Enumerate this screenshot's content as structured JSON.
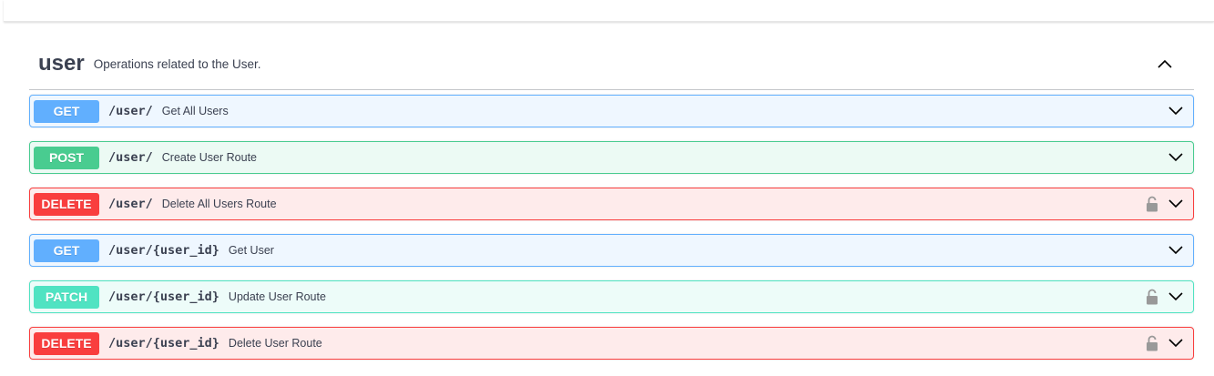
{
  "tag": {
    "name": "user",
    "description": "Operations related to the User."
  },
  "colors": {
    "get": "#61affe",
    "post": "#49cc90",
    "delete": "#f93e3e",
    "patch": "#50e3c2"
  },
  "operations": [
    {
      "method": "GET",
      "path": "/user/",
      "summary": "Get All Users",
      "locked": false
    },
    {
      "method": "POST",
      "path": "/user/",
      "summary": "Create User Route",
      "locked": false
    },
    {
      "method": "DELETE",
      "path": "/user/",
      "summary": "Delete All Users Route",
      "locked": true
    },
    {
      "method": "GET",
      "path": "/user/{user_id}",
      "summary": "Get User",
      "locked": false
    },
    {
      "method": "PATCH",
      "path": "/user/{user_id}",
      "summary": "Update User Route",
      "locked": true
    },
    {
      "method": "DELETE",
      "path": "/user/{user_id}",
      "summary": "Delete User Route",
      "locked": true
    }
  ]
}
